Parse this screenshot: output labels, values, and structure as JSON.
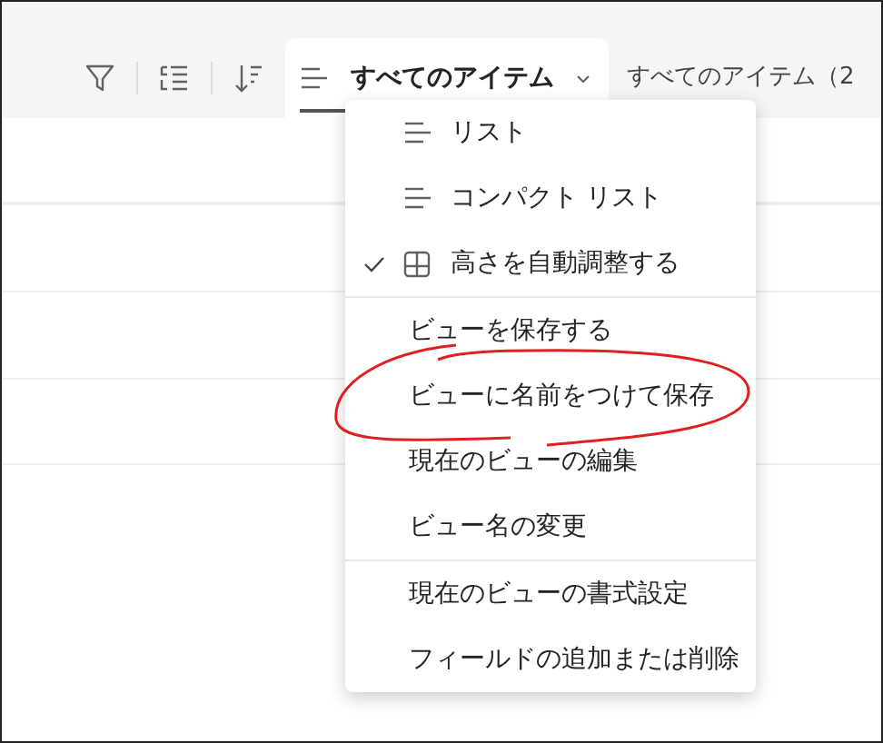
{
  "toolbar": {
    "active_view": {
      "label": "すべてのアイテム",
      "selected": true
    },
    "other_view": {
      "label": "すべてのアイテム（2",
      "selected": false
    }
  },
  "menu": {
    "sections": [
      {
        "items": [
          {
            "kind": "list",
            "label": "リスト",
            "checked": false
          },
          {
            "kind": "compact",
            "label": "コンパクト リスト",
            "checked": false
          },
          {
            "kind": "autofit",
            "label": "高さを自動調整する",
            "checked": true
          }
        ]
      },
      {
        "items": [
          {
            "kind": "action",
            "label": "ビューを保存する"
          },
          {
            "kind": "action",
            "label": "ビューに名前をつけて保存"
          },
          {
            "kind": "action",
            "label": "現在のビューの編集"
          },
          {
            "kind": "action",
            "label": "ビュー名の変更"
          }
        ]
      },
      {
        "items": [
          {
            "kind": "action",
            "label": "現在のビューの書式設定"
          },
          {
            "kind": "action",
            "label": "フィールドの追加または削除"
          }
        ]
      }
    ]
  }
}
